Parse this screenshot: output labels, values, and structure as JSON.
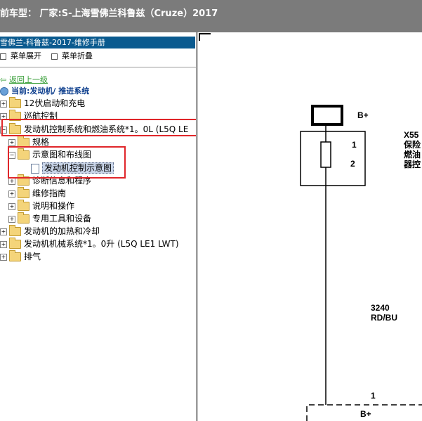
{
  "window": {
    "title": "前车型： 厂家:S-上海雪佛兰科鲁兹（Cruze）2017"
  },
  "left": {
    "header": "雪佛兰-科鲁兹-2017-维修手册",
    "menu": {
      "expand": "菜单展开",
      "collapse": "菜单折叠"
    },
    "back": "返回上一级",
    "current": "当前:发动机/ 推进系统",
    "tree": {
      "n1": "12伏启动和充电",
      "n2": "巡航控制",
      "n3": "发动机控制系统和燃油系统*1。0L (L5Q LE",
      "n3_1": "规格",
      "n3_2": "示意图和布线图",
      "n3_2_1": "发动机控制示意图",
      "n3_3": "诊断信息和程序",
      "n3_4": "维修指南",
      "n3_5": "说明和操作",
      "n3_6": "专用工具和设备",
      "n4": "发动机的加热和冷却",
      "n5": "发动机机械系统*1。0升 (L5Q LE1 LWT)",
      "n6": "排气"
    }
  },
  "diagram": {
    "b_plus_top": "B+",
    "pin1": "1",
    "pin2": "2",
    "x55_l1": "X55",
    "x55_l2": "保险",
    "x55_l3": "燃油",
    "x55_l4": "器控",
    "wire_num": "3240",
    "wire_color": "RD/BU",
    "pin1_bottom": "1",
    "b_plus_bottom": "B+"
  },
  "colors": {
    "highlight": "#e0262a",
    "header_bg": "#0a5a8f",
    "topbar_bg": "#7b7b7b"
  }
}
